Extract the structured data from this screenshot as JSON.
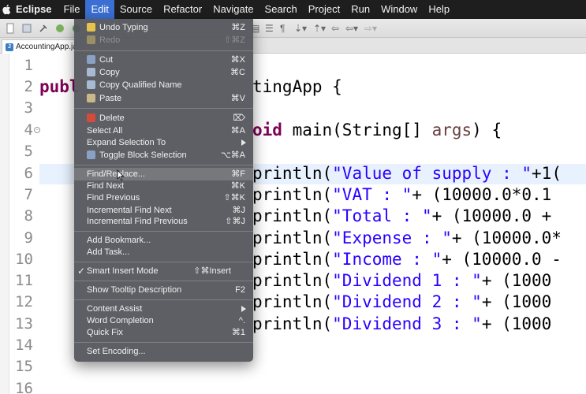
{
  "menubar": {
    "app_name": "Eclipse",
    "items": [
      "File",
      "Edit",
      "Source",
      "Refactor",
      "Navigate",
      "Search",
      "Project",
      "Run",
      "Window",
      "Help"
    ],
    "active": "Edit"
  },
  "editor": {
    "tab_title": "AccountingApp.java",
    "line_numbers": [
      "1",
      "2",
      "3",
      "4",
      "5",
      "6",
      "7",
      "8",
      "9",
      "10",
      "11",
      "12",
      "13",
      "14",
      "15",
      "16"
    ],
    "lines": {
      "l2_kw": "publ",
      "l2_rest": "tingApp {",
      "l4_kw": "oid",
      "l4_rest": " main(String[] ",
      "l4_param": "args",
      "l4_end": ") {",
      "l6_a": "println(",
      "l6_s": "\"Value of supply : \"",
      "l6_b": "+1(",
      "l7_a": "println(",
      "l7_s": "\"VAT : \"",
      "l7_b": "+ (10000.0*0.1",
      "l8_a": "println(",
      "l8_s": "\"Total : \"",
      "l8_b": "+ (10000.0 +",
      "l9_a": "println(",
      "l9_s": "\"Expense : \"",
      "l9_b": "+ (10000.0*",
      "l10_a": "println(",
      "l10_s": "\"Income : \"",
      "l10_b": "+ (10000.0 -",
      "l11_a": "println(",
      "l11_s": "\"Dividend 1 : \"",
      "l11_b": "+ (1000",
      "l12_a": "println(",
      "l12_s": "\"Dividend 2 : \"",
      "l12_b": "+ (1000",
      "l13_a": "println(",
      "l13_s": "\"Dividend 3 : \"",
      "l13_b": "+ (1000"
    }
  },
  "edit_menu": {
    "undo": {
      "label": "Undo Typing",
      "shortcut": "⌘Z"
    },
    "redo": {
      "label": "Redo",
      "shortcut": "⇧⌘Z"
    },
    "cut": {
      "label": "Cut",
      "shortcut": "⌘X"
    },
    "copy": {
      "label": "Copy",
      "shortcut": "⌘C"
    },
    "copy_qualified": {
      "label": "Copy Qualified Name"
    },
    "paste": {
      "label": "Paste",
      "shortcut": "⌘V"
    },
    "delete": {
      "label": "Delete",
      "shortcut": "⌦"
    },
    "select_all": {
      "label": "Select All",
      "shortcut": "⌘A"
    },
    "expand_selection": {
      "label": "Expand Selection To"
    },
    "toggle_block": {
      "label": "Toggle Block Selection",
      "shortcut": "⌥⌘A"
    },
    "find_replace": {
      "label": "Find/Replace...",
      "shortcut": "⌘F"
    },
    "find_next": {
      "label": "Find Next",
      "shortcut": "⌘K"
    },
    "find_previous": {
      "label": "Find Previous",
      "shortcut": "⇧⌘K"
    },
    "incr_find_next": {
      "label": "Incremental Find Next",
      "shortcut": "⌘J"
    },
    "incr_find_prev": {
      "label": "Incremental Find Previous",
      "shortcut": "⇧⌘J"
    },
    "add_bookmark": {
      "label": "Add Bookmark..."
    },
    "add_task": {
      "label": "Add Task..."
    },
    "smart_insert": {
      "label": "Smart Insert Mode",
      "shortcut": "⇧⌘Insert",
      "check": "✓"
    },
    "tooltip": {
      "label": "Show Tooltip Description",
      "shortcut": "F2"
    },
    "content_assist": {
      "label": "Content Assist"
    },
    "word_completion": {
      "label": "Word Completion",
      "shortcut": "^."
    },
    "quick_fix": {
      "label": "Quick Fix",
      "shortcut": "⌘1"
    },
    "set_encoding": {
      "label": "Set Encoding..."
    }
  }
}
